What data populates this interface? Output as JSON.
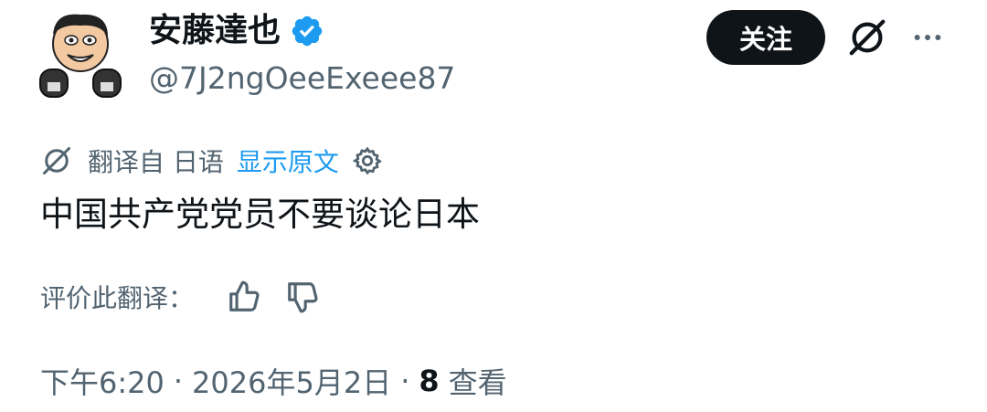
{
  "user": {
    "display_name": "安藤達也",
    "handle": "@7J2ngOeeExeee87",
    "verified": true,
    "avatar_icon": "boxer-cartoon-avatar"
  },
  "actions": {
    "follow_label": "关注",
    "grok_icon": "grok-icon",
    "more_icon": "more-horizontal-icon"
  },
  "translation": {
    "label": "翻译自 日语",
    "show_original": "显示原文",
    "settings_icon": "gear-icon"
  },
  "tweet": {
    "text": "中国共产党党员不要谈论日本"
  },
  "rating": {
    "label": "评价此翻译：",
    "thumbs_up_icon": "thumbs-up-icon",
    "thumbs_down_icon": "thumbs-down-icon"
  },
  "meta": {
    "time": "下午6:20",
    "separator": "·",
    "date": "2026年5月2日",
    "views_count": "8",
    "views_label": "查看"
  },
  "colors": {
    "text_primary": "#0f1419",
    "text_secondary": "#536471",
    "link": "#1d9bf0",
    "verified_badge": "#1d9bf0",
    "button_bg": "#0f1419"
  }
}
